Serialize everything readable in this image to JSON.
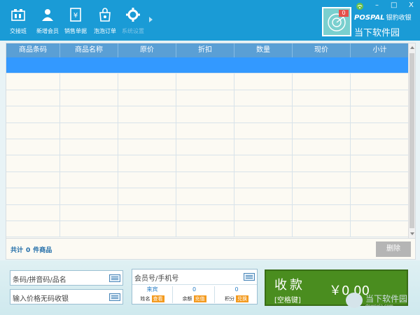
{
  "toolbar": {
    "items": [
      {
        "label": "交接班",
        "icon": "handover-icon"
      },
      {
        "label": "新增会员",
        "icon": "add-member-icon"
      },
      {
        "label": "销售单据",
        "icon": "sales-receipt-icon"
      },
      {
        "label": "泡泡订单",
        "icon": "shopping-bag-icon"
      },
      {
        "label": "系统设置",
        "icon": "gear-icon"
      }
    ]
  },
  "window": {
    "minimize": "–",
    "maximize": "□",
    "close": "X"
  },
  "brand": {
    "logo_en": "POSPAL",
    "logo_cn": "银豹收银",
    "title": "当下软件园"
  },
  "notification": {
    "count": "0"
  },
  "table": {
    "headers": [
      "商品条码",
      "商品名称",
      "原价",
      "折扣",
      "数量",
      "现价",
      "小计"
    ]
  },
  "summary": {
    "prefix": "共计",
    "count": "0",
    "suffix": "件商品"
  },
  "delete_label": "删除",
  "inputs": {
    "barcode_placeholder": "条码/拼音码/品名",
    "price_placeholder": "输入价格无码收银",
    "member_placeholder": "会员号/手机号"
  },
  "member": {
    "name_value": "来宾",
    "name_label": "姓名",
    "name_tag": "查看",
    "balance_value": "0",
    "balance_label": "余额",
    "balance_tag": "充值",
    "points_value": "0",
    "points_label": "积分",
    "points_tag": "兑换"
  },
  "payment": {
    "label": "收款",
    "key_hint": "[空格键]",
    "amount": "￥0.00"
  },
  "watermark": {
    "text": "当下软件园",
    "sub": "downxia.com"
  },
  "colors": {
    "toolbar": "#1a9bd6",
    "header": "#5a9fd5",
    "selected_row": "#3399ff",
    "pay": "#4a8d1f",
    "tag": "#f39a1e"
  }
}
